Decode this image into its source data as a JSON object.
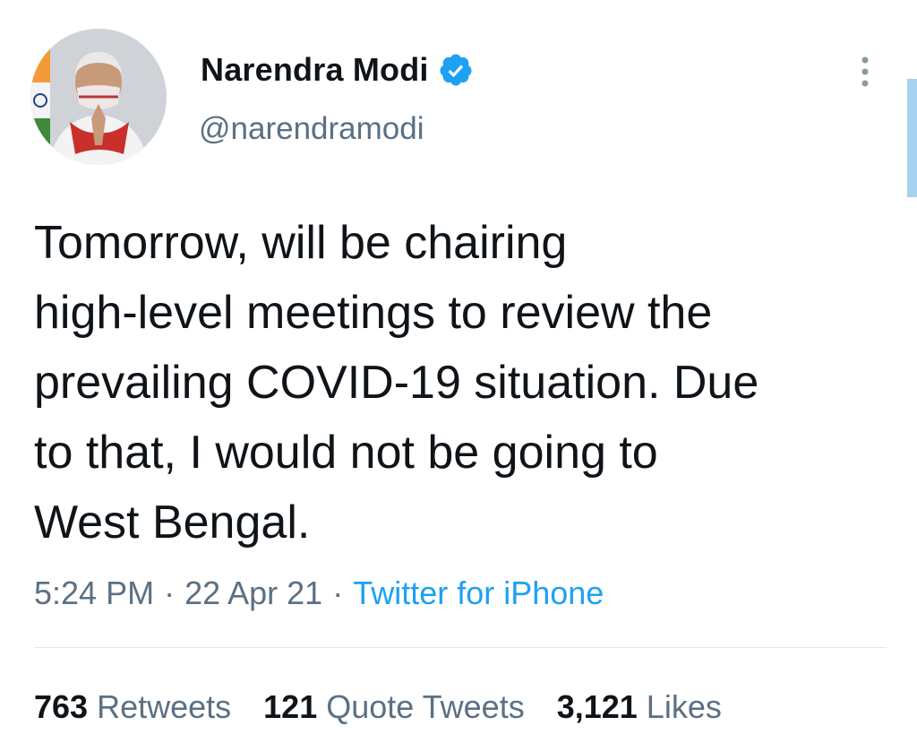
{
  "author": {
    "display_name": "Narendra Modi",
    "handle": "@narendramodi",
    "verified": true,
    "verified_color": "#1da1f2"
  },
  "tweet": {
    "text": "Tomorrow, will be chairing\nhigh-level meetings to review the\nprevailing COVID-19 situation. Due\nto that, I would not be going to\nWest Bengal.",
    "time": "5:24 PM",
    "date": "22 Apr 21",
    "separator": "·",
    "source": "Twitter for iPhone"
  },
  "stats": {
    "retweets_count": "763",
    "retweets_label": "Retweets",
    "quotes_count": "121",
    "quotes_label": "Quote Tweets",
    "likes_count": "3,121",
    "likes_label": "Likes"
  },
  "icons": {
    "verified": "verified-badge-icon",
    "more": "more-vertical-icon"
  },
  "colors": {
    "text_primary": "#0f1419",
    "text_secondary": "#5b7083",
    "link": "#1da1f2",
    "divider": "#e1e8ed"
  }
}
